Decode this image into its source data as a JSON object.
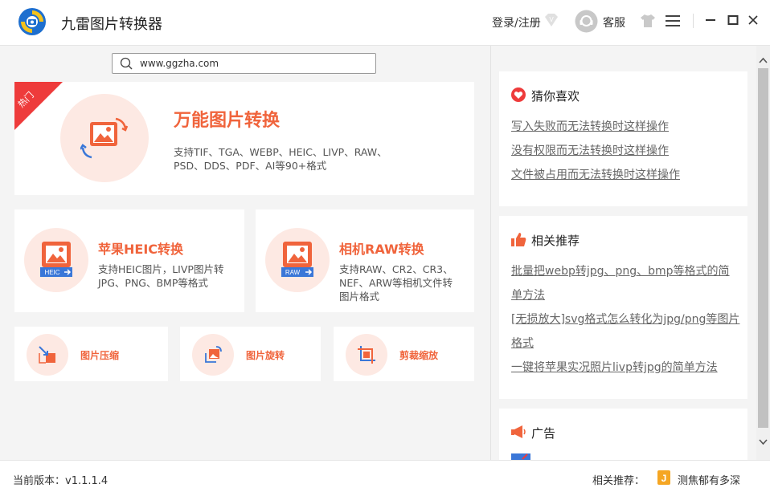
{
  "app": {
    "title": "九雷图片转换器",
    "login": "登录/注册",
    "service": "客服"
  },
  "search": {
    "value": "www.ggzha.com"
  },
  "main_card": {
    "badge": "热门",
    "title": "万能图片转换",
    "desc_line1": "支持TIF、TGA、WEBP、HEIC、LIVP、RAW、",
    "desc_line2": "PSD、DDS、PDF、AI等90+格式"
  },
  "heic_card": {
    "title": "苹果HEIC转换",
    "desc_line1": "支持HEIC图片，LIVP图片转",
    "desc_line2": "JPG、PNG、BMP等格式",
    "icon_label": "HEIC"
  },
  "raw_card": {
    "title": "相机RAW转换",
    "desc_line1": "支持RAW、CR2、CR3、",
    "desc_line2": "NEF、ARW等相机文件转",
    "desc_line3": "图片格式",
    "icon_label": "RAW"
  },
  "small_cards": [
    {
      "label": "图片压缩"
    },
    {
      "label": "图片旋转"
    },
    {
      "label": "剪裁缩放"
    }
  ],
  "guess": {
    "title": "猜你喜欢",
    "links": [
      "写入失败而无法转换时这样操作",
      "没有权限而无法转换时这样操作",
      "文件被占用而无法转换时这样操作"
    ]
  },
  "related": {
    "title": "相关推荐",
    "links": [
      "批量把webp转jpg、png、bmp等格式的简单方法",
      "[无损放大]svg格式怎么转化为jpg/png等图片格式",
      "一键将苹果实况照片livp转jpg的简单方法"
    ]
  },
  "ad": {
    "title": "广告"
  },
  "footer": {
    "version": "当前版本：v1.1.1.4",
    "related_label": "相关推荐：",
    "related_app": "测焦郁有多深"
  },
  "colors": {
    "accent": "#f0643c",
    "hot": "#ee3b3b",
    "icon_bg": "#fde9e3"
  }
}
